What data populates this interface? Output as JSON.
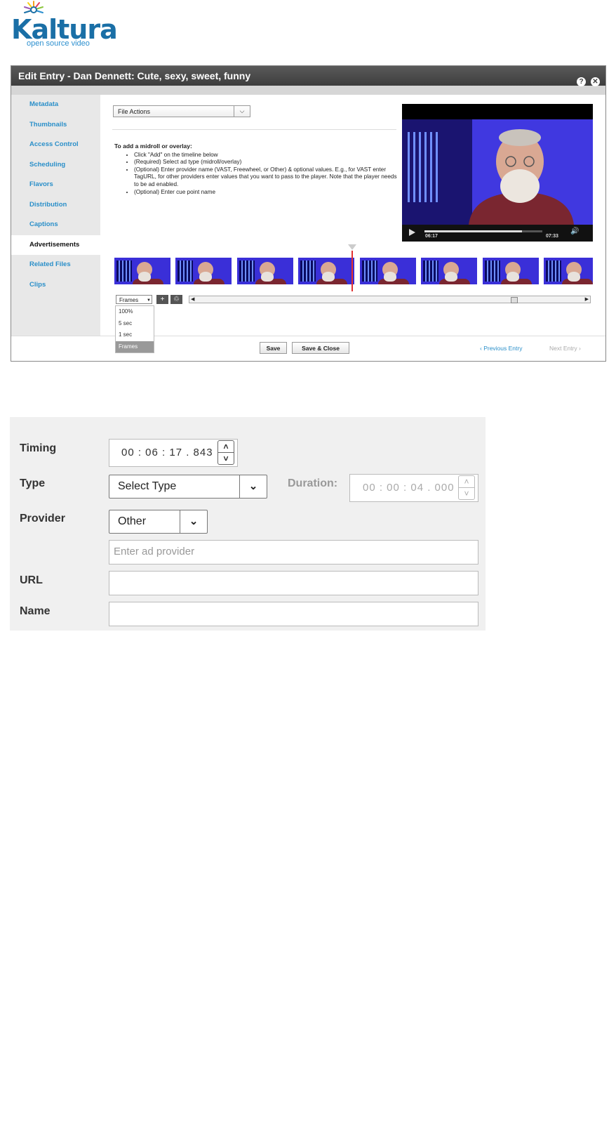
{
  "logo": {
    "name": "Kaltura",
    "tagline": "open source video"
  },
  "dialog": {
    "title": "Edit Entry - Dan Dennett: Cute, sexy, sweet, funny",
    "help_icon": "?",
    "close_icon": "✕",
    "sidebar": [
      "Metadata",
      "Thumbnails",
      "Access Control",
      "Scheduling",
      "Flavors",
      "Distribution",
      "Captions",
      "Advertisements",
      "Related Files",
      "Clips"
    ],
    "active_tab": "Advertisements",
    "file_actions": "File Actions",
    "instructions": {
      "heading": "To add a midroll or overlay:",
      "items": [
        "Click \"Add\" on the timeline below",
        "(Required) Select ad type (midroll/overlay)",
        "(Optional) Enter provider name (VAST, Freewheel, or Other) & optional values. E.g., for VAST enter TagURL, for other providers enter values that you want to pass to the player. Note that the player needs to be ad enabled.",
        "(Optional) Enter cue point name"
      ]
    },
    "player": {
      "current_time": "06:17",
      "duration": "07:33",
      "progress": 0.83
    },
    "timeline": {
      "zoom_value": "Frames",
      "zoom_options": [
        "100%",
        "5 sec",
        "1 sec",
        "Frames"
      ],
      "add_label": "+",
      "delete_label": "🗑"
    },
    "footer": {
      "save": "Save",
      "save_close": "Save & Close",
      "prev": "‹ Previous Entry",
      "next": "Next Entry ›"
    }
  },
  "ad_form": {
    "timing_label": "Timing",
    "timing_value": "00 : 06 : 17 . 843",
    "type_label": "Type",
    "type_value": "Select Type",
    "duration_label": "Duration:",
    "duration_value": "00 : 00 : 04 . 000",
    "provider_label": "Provider",
    "provider_value": "Other",
    "provider_placeholder": "Enter ad provider",
    "url_label": "URL",
    "name_label": "Name"
  },
  "colors": {
    "accent": "#2a8fc9",
    "playhead": "#e03030",
    "video_bg": "#3a2fd8"
  }
}
